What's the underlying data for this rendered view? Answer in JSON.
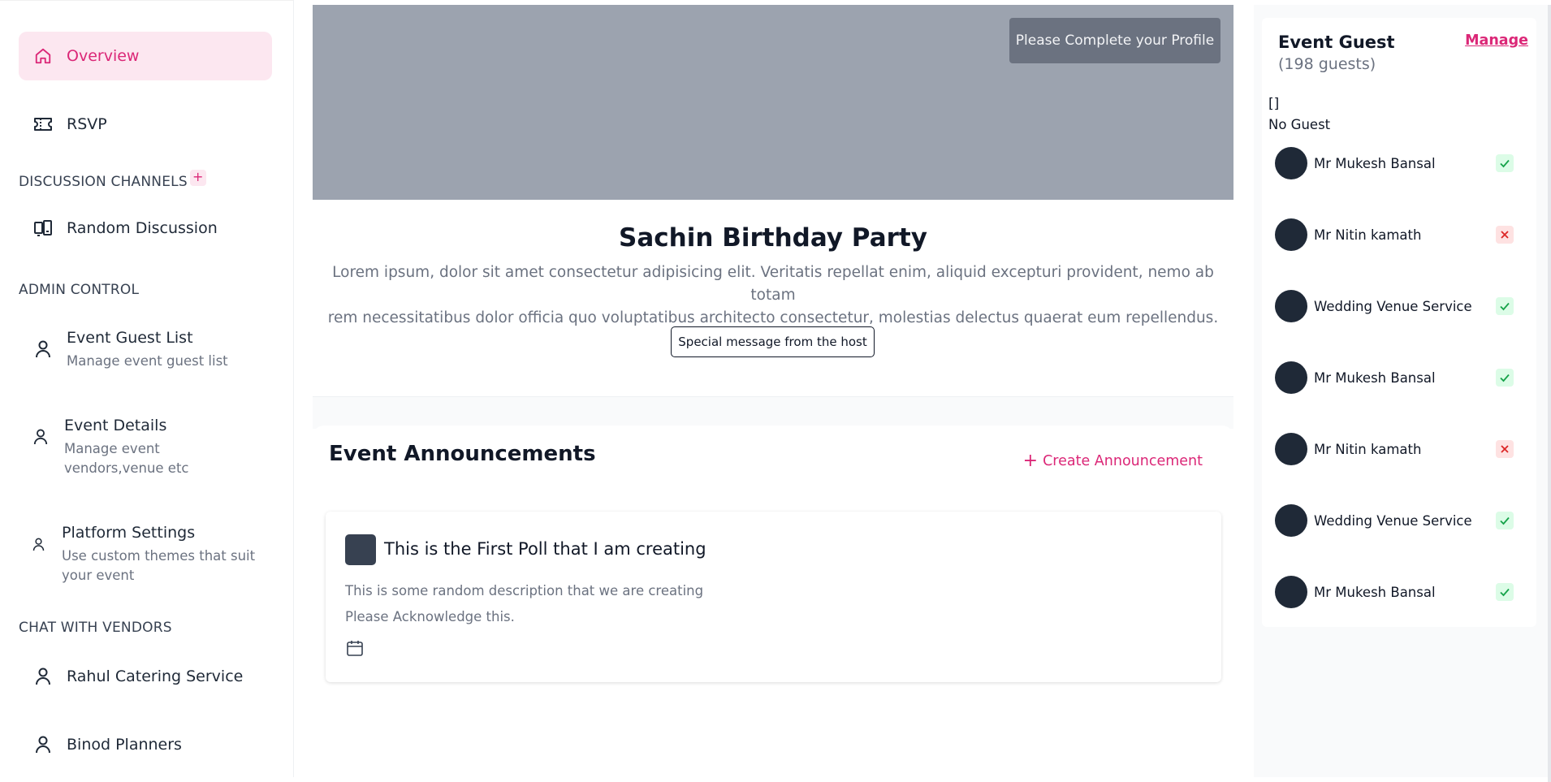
{
  "sidebar": {
    "overview": "Overview",
    "rsvp": "RSVP",
    "discussion_title": "DISCUSSION CHANNELS",
    "discussion_add": "+",
    "random_discussion": "Random Discussion",
    "admin_title": "ADMIN CONTROL",
    "guest_list": {
      "title": "Event Guest List",
      "sub": "Manage event guest list"
    },
    "event_details": {
      "title": "Event Details",
      "sub1": "Manage event",
      "sub2": "vendors,venue etc"
    },
    "platform_settings": {
      "title": "Platform Settings",
      "sub1": "Use custom themes that suit",
      "sub2": "your event"
    },
    "vendors_title": "CHAT WITH VENDORS",
    "vendors": [
      "Rahul Catering Service",
      "Binod Planners"
    ]
  },
  "main": {
    "profile_button": "Please Complete your Profile",
    "event_title": "Sachin Birthday Party",
    "event_desc_1": "Lorem ipsum, dolor sit amet consectetur adipisicing elit. Veritatis repellat enim, aliquid excepturi provident, nemo ab totam",
    "event_desc_2": "rem necessitatibus dolor officia quo voluptatibus architecto consectetur, molestias delectus quaerat eum repellendus.",
    "host_button": "Special message from the host",
    "announcements_title": "Event Announcements",
    "create_announcement": "Create Announcement",
    "create_plus": "+",
    "poll": {
      "title": "This is the First Poll that I am creating",
      "description": "This is some random description that we are creating",
      "ack": "Please Acknowledge this."
    }
  },
  "guests": {
    "title": "Event Guest",
    "count": "(198 guests)",
    "manage": "Manage",
    "raw": "[]",
    "empty": "No Guest",
    "list": [
      {
        "name": "Mr Mukesh Bansal",
        "status": "accepted"
      },
      {
        "name": "Mr Nitin kamath",
        "status": "declined"
      },
      {
        "name": "Wedding Venue Service",
        "status": "accepted"
      },
      {
        "name": "Mr Mukesh Bansal",
        "status": "accepted"
      },
      {
        "name": "Mr Nitin kamath",
        "status": "declined"
      },
      {
        "name": "Wedding Venue Service",
        "status": "accepted"
      },
      {
        "name": "Mr Mukesh Bansal",
        "status": "accepted"
      }
    ]
  },
  "colors": {
    "accent": "#db2777",
    "accent_bg": "#fce7f0",
    "banner": "#9ca3af",
    "accepted": "#16a34a",
    "declined": "#dc2626"
  }
}
